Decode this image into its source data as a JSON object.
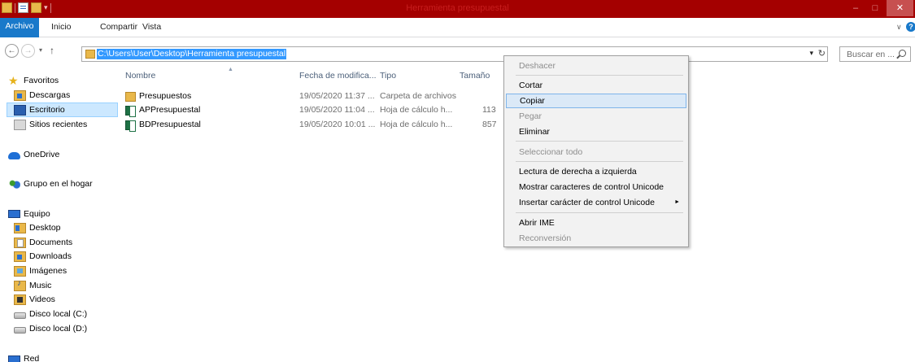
{
  "window": {
    "title": "Herramienta presupuestal",
    "min_glyph": "–",
    "max_glyph": "□",
    "close_glyph": "✕"
  },
  "quick_access": {
    "dropdown_glyph": "▾"
  },
  "ribbon": {
    "file_tab": "Archivo",
    "tabs": [
      "Inicio",
      "Compartir",
      "Vista"
    ],
    "expand_glyph": "∨",
    "help_glyph": "?"
  },
  "address": {
    "back_glyph": "←",
    "forward_glyph": "→",
    "recent_glyph": "▾",
    "up_glyph": "↑",
    "path": "C:\\Users\\User\\Desktop\\Herramienta presupuestal",
    "dropdown_glyph": "▾",
    "refresh_glyph": "↻",
    "search_placeholder": "Buscar en ..."
  },
  "nav": {
    "favorites": "Favoritos",
    "fav_items": [
      "Descargas",
      "Escritorio",
      "Sitios recientes"
    ],
    "onedrive": "OneDrive",
    "homegroup": "Grupo en el hogar",
    "computer": "Equipo",
    "computer_items": [
      "Desktop",
      "Documents",
      "Downloads",
      "Imágenes",
      "Music",
      "Videos",
      "Disco local (C:)",
      "Disco local (D:)"
    ],
    "network": "Red",
    "star_glyph": "★"
  },
  "files": {
    "columns": {
      "name": "Nombre",
      "date": "Fecha de modifica...",
      "type": "Tipo",
      "size": "Tamaño"
    },
    "sort_glyph": "▲",
    "rows": [
      {
        "name": "Presupuestos",
        "date": "19/05/2020 11:37 ...",
        "type": "Carpeta de archivos",
        "size": "",
        "kind": "folder-icon"
      },
      {
        "name": "APPresupuestal",
        "date": "19/05/2020 11:04 ...",
        "type": "Hoja de cálculo h...",
        "size": "113",
        "kind": "excel-icon"
      },
      {
        "name": "BDPresupuestal",
        "date": "19/05/2020 10:01 ...",
        "type": "Hoja de cálculo h...",
        "size": "857",
        "kind": "excel-icon"
      }
    ]
  },
  "context_menu": {
    "undo": "Deshacer",
    "cut": "Cortar",
    "copy": "Copiar",
    "paste": "Pegar",
    "delete": "Eliminar",
    "select_all": "Seleccionar todo",
    "rtl": "Lectura de derecha a izquierda",
    "show_unicode": "Mostrar caracteres de control Unicode",
    "insert_unicode": "Insertar carácter de control Unicode",
    "submenu_glyph": "►",
    "open_ime": "Abrir IME",
    "reconvert": "Reconversión"
  },
  "colors": {
    "title_bar": "#a40000",
    "file_tab": "#1979ca",
    "selection": "#3399ff",
    "close_button": "#c75050"
  }
}
